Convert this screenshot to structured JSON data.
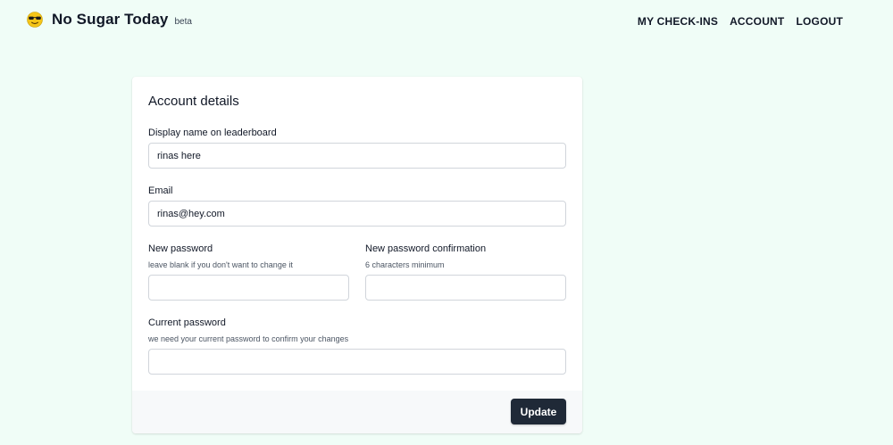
{
  "header": {
    "logo_icon": "sunglasses-face-icon",
    "brand_name": "No Sugar Today",
    "brand_badge": "beta",
    "nav": [
      {
        "label": "MY CHECK-INS"
      },
      {
        "label": "ACCOUNT"
      },
      {
        "label": "LOGOUT"
      }
    ]
  },
  "form": {
    "title": "Account details",
    "display_name": {
      "label": "Display name on leaderboard",
      "value": "rinas here"
    },
    "email": {
      "label": "Email",
      "value": "rinas@hey.com"
    },
    "new_password": {
      "label": "New password",
      "hint": "leave blank if you don't want to change it",
      "value": ""
    },
    "new_password_confirmation": {
      "label": "New password confirmation",
      "hint": "6 characters minimum",
      "value": ""
    },
    "current_password": {
      "label": "Current password",
      "hint": "we need your current password to confirm your changes",
      "value": ""
    },
    "submit_label": "Update"
  },
  "colors": {
    "page_background": "#f0fdf7",
    "button_background": "#1f2937",
    "footer_background": "#f7f9fa"
  }
}
